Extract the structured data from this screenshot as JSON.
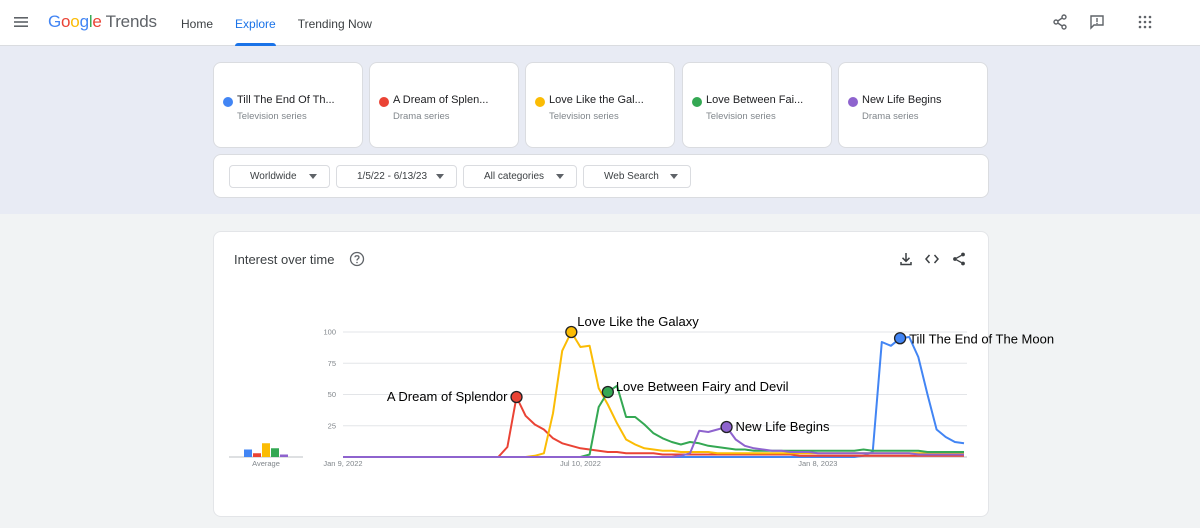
{
  "header": {
    "brand_letters": [
      {
        "ch": "G",
        "color": "#4285F4"
      },
      {
        "ch": "o",
        "color": "#EA4335"
      },
      {
        "ch": "o",
        "color": "#FBBC05"
      },
      {
        "ch": "g",
        "color": "#4285F4"
      },
      {
        "ch": "l",
        "color": "#34A853"
      },
      {
        "ch": "e",
        "color": "#EA4335"
      }
    ],
    "product": "Trends",
    "tabs": [
      {
        "label": "Home",
        "active": false
      },
      {
        "label": "Explore",
        "active": true
      },
      {
        "label": "Trending Now",
        "active": false
      }
    ],
    "icons": [
      "menu-icon",
      "share-icon",
      "feedback-icon",
      "apps-icon"
    ]
  },
  "terms": [
    {
      "name": "Till The End Of Th...",
      "type": "Television series",
      "color": "#4285F4"
    },
    {
      "name": "A Dream of Splen...",
      "type": "Drama series",
      "color": "#EA4335"
    },
    {
      "name": "Love Like the Gal...",
      "type": "Television series",
      "color": "#FBBC04"
    },
    {
      "name": "Love Between Fai...",
      "type": "Television series",
      "color": "#34A853"
    },
    {
      "name": "New Life Begins",
      "type": "Drama series",
      "color": "#8E63CE"
    }
  ],
  "filters": {
    "region": "Worldwide",
    "dates": "1/5/22 - 6/13/23",
    "category": "All categories",
    "search_type": "Web Search"
  },
  "interest": {
    "title": "Interest over time",
    "average_label": "Average",
    "actions": [
      "download-icon",
      "embed-icon",
      "share-icon"
    ]
  },
  "chart_data": {
    "type": "line",
    "title": "Interest over time",
    "x_start": "2022-01-09",
    "x_step_days": 7,
    "x_ticks": [
      "Jan 9, 2022",
      "Jul 10, 2022",
      "Jan 8, 2023"
    ],
    "y_ticks": [
      25,
      50,
      75,
      100
    ],
    "ylim": [
      0,
      100
    ],
    "grid": true,
    "averages": [
      {
        "series": "Till The End of The Moon",
        "value": 6
      },
      {
        "series": "A Dream of Splendor",
        "value": 3
      },
      {
        "series": "Love Like the Galaxy",
        "value": 11
      },
      {
        "series": "Love Between Fairy and Devil",
        "value": 7
      },
      {
        "series": "New Life Begins",
        "value": 2
      }
    ],
    "annotations": [
      {
        "text": "Love Like the Galaxy",
        "series": "Love Like the Galaxy",
        "week": 25
      },
      {
        "text": "A Dream of Splendor",
        "series": "A Dream of Splendor",
        "week": 19
      },
      {
        "text": "Love Between Fairy and Devil",
        "series": "Love Between Fairy and Devil",
        "week": 29
      },
      {
        "text": "New Life Begins",
        "series": "New Life Begins",
        "week": 42
      },
      {
        "text": "Till The End of The Moon",
        "series": "Till The End of The Moon",
        "week": 61
      }
    ],
    "series": [
      {
        "name": "Till The End of The Moon",
        "color": "#4285F4",
        "values": [
          0,
          0,
          0,
          0,
          0,
          0,
          0,
          0,
          0,
          0,
          0,
          0,
          0,
          0,
          0,
          0,
          0,
          0,
          0,
          0,
          0,
          0,
          0,
          0,
          0,
          0,
          0,
          0,
          0,
          0,
          0,
          0,
          0,
          0,
          0,
          0,
          0,
          0,
          0,
          0,
          0,
          0,
          0,
          0,
          0,
          0,
          0,
          0,
          0,
          0,
          0,
          0,
          0,
          0,
          0,
          0,
          0,
          1,
          4,
          92,
          89,
          95,
          96,
          80,
          50,
          22,
          16,
          12,
          11
        ]
      },
      {
        "name": "A Dream of Splendor",
        "color": "#EA4335",
        "values": [
          0,
          0,
          0,
          0,
          0,
          0,
          0,
          0,
          0,
          0,
          0,
          0,
          0,
          0,
          0,
          0,
          0,
          0,
          8,
          48,
          33,
          26,
          22,
          15,
          11,
          9,
          7,
          6,
          5,
          4,
          4,
          3,
          3,
          3,
          3,
          2,
          2,
          2,
          2,
          2,
          2,
          2,
          2,
          2,
          2,
          2,
          2,
          2,
          2,
          2,
          1,
          1,
          1,
          1,
          1,
          1,
          1,
          1,
          1,
          1,
          1,
          1,
          1,
          1,
          1,
          1,
          1,
          1,
          1
        ]
      },
      {
        "name": "Love Like the Galaxy",
        "color": "#FBBC04",
        "values": [
          0,
          0,
          0,
          0,
          0,
          0,
          0,
          0,
          0,
          0,
          0,
          0,
          0,
          0,
          0,
          0,
          0,
          0,
          0,
          0,
          0,
          1,
          3,
          35,
          85,
          100,
          88,
          89,
          55,
          42,
          27,
          14,
          10,
          7,
          6,
          5,
          5,
          4,
          4,
          4,
          4,
          3,
          3,
          3,
          3,
          3,
          3,
          3,
          3,
          3,
          3,
          3,
          3,
          3,
          3,
          3,
          3,
          3,
          3,
          3,
          3,
          3,
          3,
          3,
          3,
          3,
          3,
          3,
          3
        ]
      },
      {
        "name": "Love Between Fairy and Devil",
        "color": "#34A853",
        "values": [
          0,
          0,
          0,
          0,
          0,
          0,
          0,
          0,
          0,
          0,
          0,
          0,
          0,
          0,
          0,
          0,
          0,
          0,
          0,
          0,
          0,
          0,
          0,
          0,
          0,
          0,
          0,
          2,
          40,
          52,
          57,
          32,
          32,
          26,
          19,
          15,
          12,
          10,
          12,
          11,
          9,
          8,
          7,
          6,
          6,
          5,
          5,
          5,
          5,
          5,
          5,
          5,
          5,
          5,
          5,
          5,
          5,
          6,
          5,
          5,
          5,
          5,
          5,
          5,
          4,
          4,
          4,
          4,
          4
        ]
      },
      {
        "name": "New Life Begins",
        "color": "#8E63CE",
        "values": [
          0,
          0,
          0,
          0,
          0,
          0,
          0,
          0,
          0,
          0,
          0,
          0,
          0,
          0,
          0,
          0,
          0,
          0,
          0,
          0,
          0,
          0,
          0,
          0,
          0,
          0,
          0,
          0,
          0,
          0,
          0,
          0,
          0,
          0,
          0,
          0,
          0,
          1,
          3,
          21,
          20,
          22,
          24,
          14,
          9,
          7,
          6,
          5,
          5,
          4,
          4,
          4,
          3,
          3,
          3,
          3,
          3,
          3,
          3,
          3,
          3,
          3,
          3,
          2,
          2,
          2,
          2,
          2,
          2
        ]
      }
    ]
  }
}
